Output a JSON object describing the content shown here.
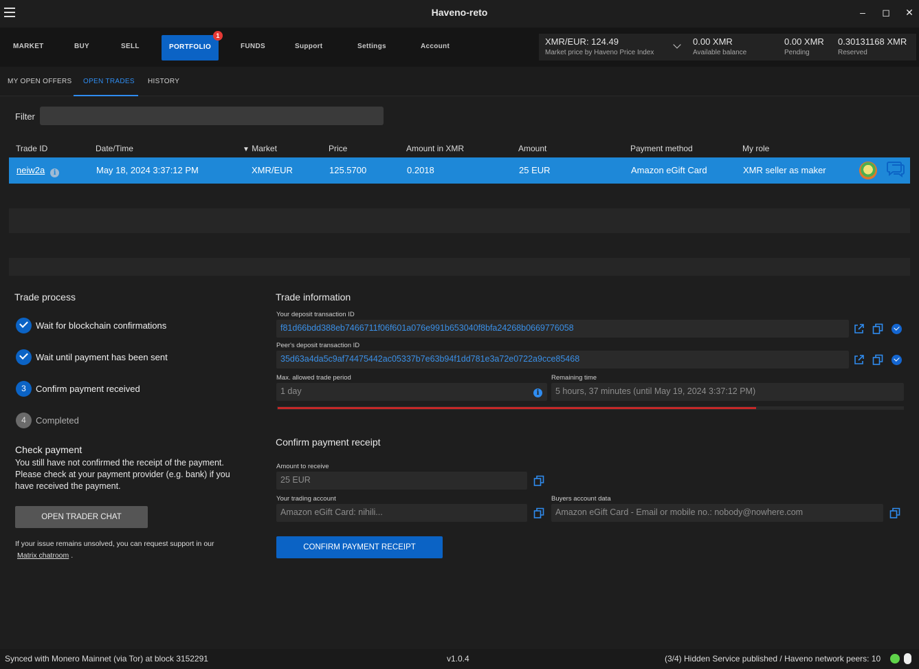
{
  "window": {
    "title": "Haveno-reto",
    "minimize_icon": "minimize-icon",
    "maximize_icon": "maximize-icon",
    "close_icon": "close-icon"
  },
  "nav": {
    "items": [
      {
        "label": "MARKET"
      },
      {
        "label": "BUY"
      },
      {
        "label": "SELL"
      },
      {
        "label": "PORTFOLIO",
        "badge": "1",
        "active": true
      },
      {
        "label": "FUNDS"
      },
      {
        "label": "Support"
      },
      {
        "label": "Settings"
      },
      {
        "label": "Account"
      }
    ]
  },
  "balance": {
    "market_price": "XMR/EUR: 124.49",
    "market_price_label": "Market price by Haveno Price Index",
    "available": "0.00 XMR",
    "available_label": "Available balance",
    "pending": "0.00 XMR",
    "pending_label": "Pending",
    "reserved": "0.30131168 XMR",
    "reserved_label": "Reserved"
  },
  "subtabs": {
    "items": [
      {
        "label": "MY OPEN OFFERS"
      },
      {
        "label": "OPEN TRADES",
        "active": true
      },
      {
        "label": "HISTORY"
      }
    ]
  },
  "filter": {
    "label": "Filter",
    "value": ""
  },
  "table": {
    "columns": [
      "Trade ID",
      "Date/Time",
      "Market",
      "Price",
      "Amount in XMR",
      "Amount",
      "Payment method",
      "My role"
    ],
    "sort_indicator": "▼",
    "rows": [
      {
        "trade_id": "neiw2a",
        "datetime": "May 18, 2024 3:37:12 PM",
        "market": "XMR/EUR",
        "price": "125.5700",
        "amount_xmr": "0.2018",
        "amount": "25 EUR",
        "payment_method": "Amazon eGift Card",
        "role": "XMR seller as maker"
      }
    ]
  },
  "trade_process": {
    "title": "Trade process",
    "steps": [
      {
        "label": "Wait for blockchain confirmations",
        "state": "done"
      },
      {
        "label": "Wait until payment has been sent",
        "state": "done"
      },
      {
        "label": "Confirm payment received",
        "state": "active",
        "number": "3"
      },
      {
        "label": "Completed",
        "state": "pending",
        "number": "4"
      }
    ]
  },
  "check_payment": {
    "title": "Check payment",
    "text": "You still have not confirmed the receipt of the payment. Please check at your payment provider (e.g. bank) if you have received the payment.",
    "chat_button": "OPEN TRADER CHAT",
    "support_text": "If your issue remains unsolved, you can request support in our",
    "support_link": "Matrix chatroom",
    "support_suffix": "."
  },
  "trade_info": {
    "title": "Trade information",
    "deposit_label": "Your deposit transaction ID",
    "deposit_value": "f81d66bdd388eb7466711f06f601a076e991b653040f8bfa24268b0669776058",
    "peer_deposit_label": "Peer's deposit transaction ID",
    "peer_deposit_value": "35d63a4da5c9af74475442ac05337b7e63b94f1dd781e3a72e0722a9cce85468",
    "max_period_label": "Max. allowed trade period",
    "max_period_value": "1 day",
    "remaining_label": "Remaining time",
    "remaining_value": "5 hours, 37 minutes (until May 19, 2024 3:37:12 PM)",
    "remaining_progress": 0.765
  },
  "confirm_receipt": {
    "title": "Confirm payment receipt",
    "amount_label": "Amount to receive",
    "amount_value": "25 EUR",
    "trading_account_label": "Your trading account",
    "trading_account_value": "Amazon eGift Card: nihili...",
    "buyer_data_label": "Buyers account data",
    "buyer_data_value": "Amazon eGift Card - Email or mobile no.: nobody@nowhere.com",
    "confirm_button": "CONFIRM PAYMENT RECEIPT"
  },
  "footer": {
    "sync_status": "Synced with Monero Mainnet (via Tor) at block 3152291",
    "version": "v1.0.4",
    "network": "(3/4) Hidden Service published / Haveno network peers: 10"
  },
  "colors": {
    "accent": "#0b63c5",
    "selected_row": "#1e88d8",
    "progress_red": "#c62828",
    "link_blue": "#3a8fe6"
  }
}
